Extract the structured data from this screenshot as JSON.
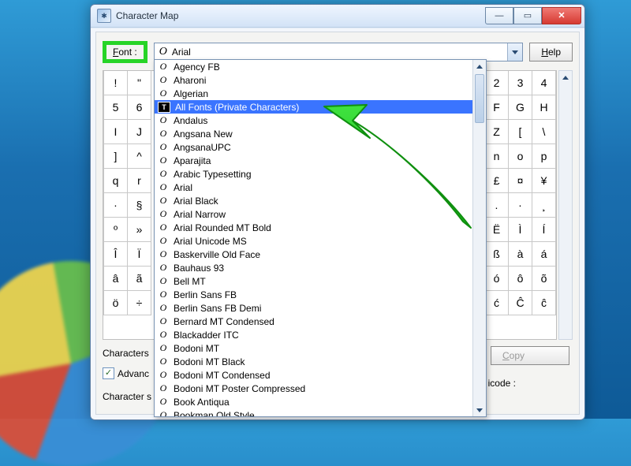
{
  "window": {
    "title": "Character Map",
    "icon_glyph": "✱"
  },
  "toprow": {
    "font_label_pre": "F",
    "font_label_post": "ont :",
    "selected_font": "Arial",
    "help_pre": "H",
    "help_post": "elp"
  },
  "font_list": [
    "Agency FB",
    "Aharoni",
    "Algerian",
    "All Fonts (Private Characters)",
    "Andalus",
    "Angsana New",
    "AngsanaUPC",
    "Aparajita",
    "Arabic Typesetting",
    "Arial",
    "Arial Black",
    "Arial Narrow",
    "Arial Rounded MT Bold",
    "Arial Unicode MS",
    "Baskerville Old Face",
    "Bauhaus 93",
    "Bell MT",
    "Berlin Sans FB",
    "Berlin Sans FB Demi",
    "Bernard MT Condensed",
    "Blackadder ITC",
    "Bodoni MT",
    "Bodoni MT Black",
    "Bodoni MT Condensed",
    "Bodoni MT Poster Compressed",
    "Book Antiqua",
    "Bookman Old Style"
  ],
  "selected_index": 3,
  "grid_right": [
    [
      "2",
      "3",
      "4"
    ],
    [
      "F",
      "G",
      "H"
    ],
    [
      "Z",
      "[",
      "\\"
    ],
    [
      "n",
      "o",
      "p"
    ],
    [
      "£",
      "¤",
      "¥"
    ],
    [
      ".",
      "·",
      "¸"
    ],
    [
      "Ë",
      "Ì",
      "Í"
    ],
    [
      "ß",
      "à",
      "á"
    ],
    [
      "ó",
      "ô",
      "õ"
    ],
    [
      "ć",
      "Ĉ",
      "ĉ"
    ]
  ],
  "grid_left": [
    [
      "!",
      "\""
    ],
    [
      "5",
      "6"
    ],
    [
      "I",
      "J"
    ],
    [
      "]",
      "^"
    ],
    [
      "q",
      "r"
    ],
    [
      "·",
      "§"
    ],
    [
      "º",
      "»"
    ],
    [
      "Î",
      "Ï"
    ],
    [
      "â",
      "ã"
    ],
    [
      "ö",
      "÷"
    ]
  ],
  "bottom": {
    "chars_to_copy_label": "Characters",
    "advanced_label": "Advanc",
    "charset_label": "Character s",
    "unicode_label": "icode :",
    "copy_pre": "C",
    "copy_post": "opy"
  }
}
